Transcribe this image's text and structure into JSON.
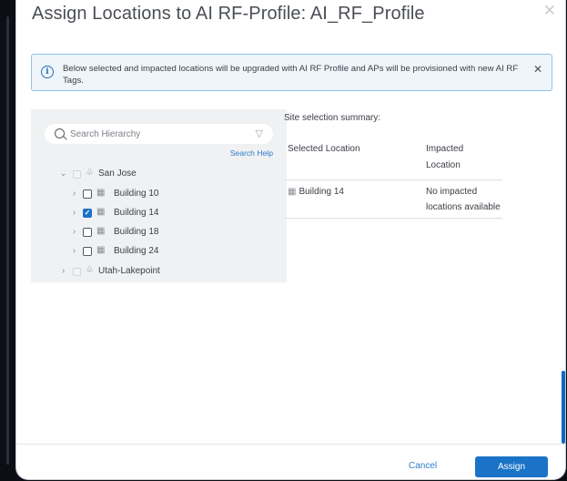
{
  "modal": {
    "title": "Assign Locations to AI RF-Profile: AI_RF_Profile",
    "close_icon": "close-icon"
  },
  "banner": {
    "message": "Below selected and impacted locations will be upgraded with AI RF Profile and APs will be provisioned with new AI RF Tags.",
    "info_icon": "info-icon",
    "close_icon": "close-icon"
  },
  "hierarchy": {
    "search_placeholder": "Search Hierarchy",
    "search_help": "Search Help",
    "nodes": [
      {
        "label": "San Jose",
        "expanded": true,
        "checked": false,
        "icon": "site-icon"
      },
      {
        "label": "Building 10",
        "expanded": false,
        "checked": false,
        "icon": "building-icon"
      },
      {
        "label": "Building 14",
        "expanded": false,
        "checked": true,
        "icon": "building-icon"
      },
      {
        "label": "Building 18",
        "expanded": false,
        "checked": false,
        "icon": "building-icon"
      },
      {
        "label": "Building 24",
        "expanded": false,
        "checked": false,
        "icon": "building-icon"
      },
      {
        "label": "Utah-Lakepoint",
        "expanded": false,
        "checked": false,
        "icon": "site-icon"
      }
    ]
  },
  "summary": {
    "title": "Site selection summary:",
    "columns": [
      "Selected Location",
      "Impacted Location"
    ],
    "rows": [
      {
        "selected": "Building 14",
        "impacted": "No impacted locations available"
      }
    ]
  },
  "footer": {
    "cancel_label": "Cancel",
    "assign_label": "Assign"
  },
  "colors": {
    "accent": "#1a73c7",
    "banner_bg": "#eef5fb",
    "banner_border": "#8cc2ea",
    "panel_bg": "#f0f1f3"
  }
}
